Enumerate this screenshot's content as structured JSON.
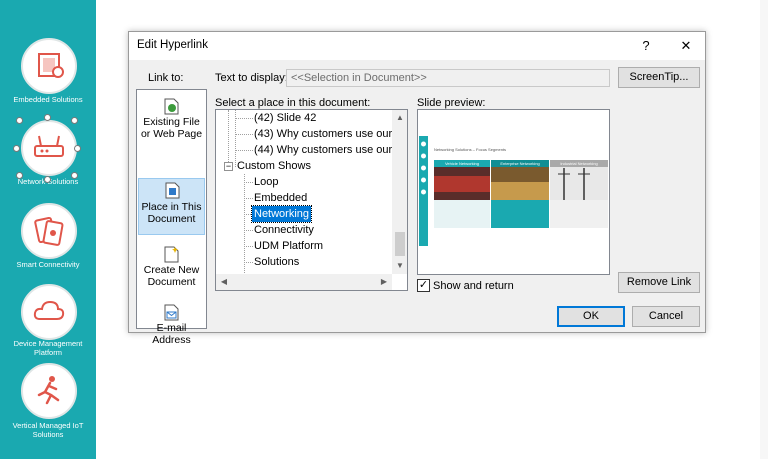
{
  "sidebar": {
    "items": [
      {
        "label": "Embedded Solutions",
        "icon": "chip-icon"
      },
      {
        "label": "Network Solutions",
        "icon": "router-icon"
      },
      {
        "label": "Smart Connectivity",
        "icon": "phone-card-icon"
      },
      {
        "label": "Device Management Platform",
        "icon": "cloud-icon"
      },
      {
        "label": "Vertical Managed IoT Solutions",
        "icon": "runner-icon"
      }
    ],
    "color": "#1aa9b0"
  },
  "dialog": {
    "title": "Edit Hyperlink",
    "help": "?",
    "close": "✕",
    "link_to_label": "Link to:",
    "text_to_display_label": "Text to display:",
    "text_to_display_value": "<<Selection in Document>>",
    "screentip": "ScreenTip...",
    "select_place_label": "Select a place in this document:",
    "slide_preview_label": "Slide preview:",
    "link_to_items": [
      {
        "line1": "Existing File",
        "line2": "or Web Page",
        "icon": "globe-file-icon"
      },
      {
        "line1": "Place in This",
        "line2": "Document",
        "icon": "document-place-icon",
        "selected": true
      },
      {
        "line1": "Create New",
        "line2": "Document",
        "icon": "new-document-icon"
      },
      {
        "line1": "E-mail",
        "line2": "Address",
        "icon": "email-icon"
      }
    ],
    "tree": {
      "items": [
        {
          "text": "(42) Slide 42"
        },
        {
          "text": "(43) Why customers use our"
        },
        {
          "text": "(44) Why customers use our"
        },
        {
          "text": "Custom Shows",
          "expander": "−"
        },
        {
          "text": "Loop"
        },
        {
          "text": "Embedded"
        },
        {
          "text": "Networking",
          "selected": true
        },
        {
          "text": "Connectivity"
        },
        {
          "text": "UDM Platform"
        },
        {
          "text": "Solutions"
        }
      ]
    },
    "preview": {
      "slide_title": "Networking Solutions – Focus Segments",
      "columns": [
        "Vehicle Networking",
        "Enterprise Networking",
        "Industrial Networking"
      ]
    },
    "show_and_return": "Show and return",
    "show_and_return_checked": "✓",
    "remove_link": "Remove Link",
    "ok": "OK",
    "cancel": "Cancel"
  }
}
